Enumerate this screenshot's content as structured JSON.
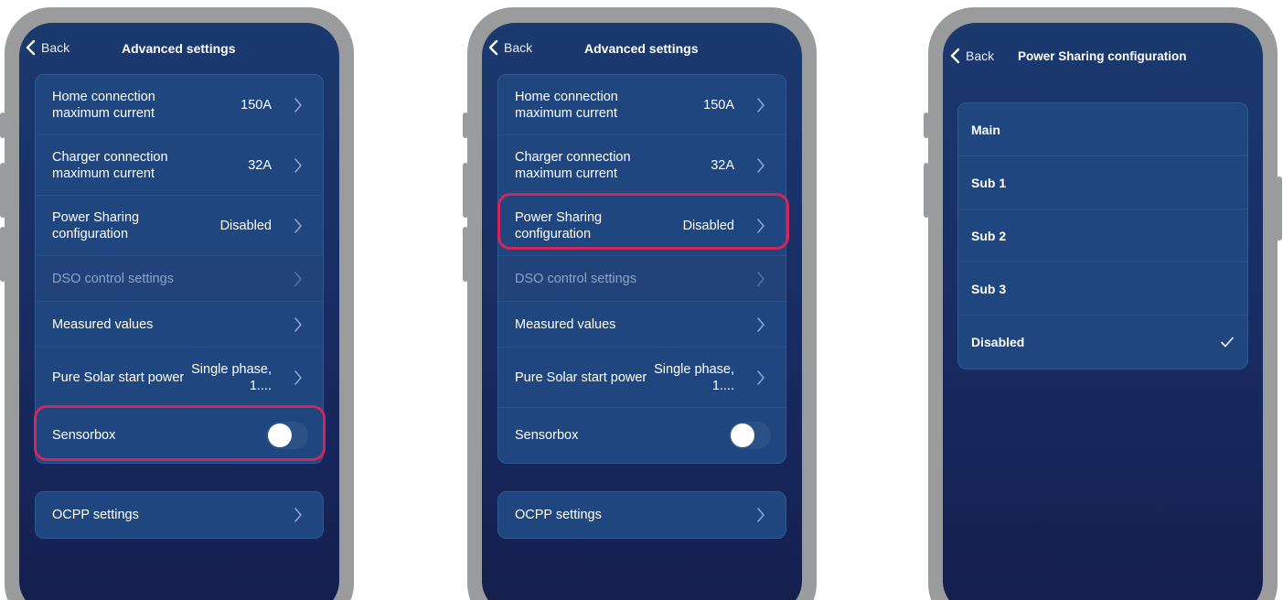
{
  "panels": [
    {
      "back_label": "Back",
      "title": "Advanced settings",
      "rows": [
        {
          "label": "Home connection maximum current",
          "value": "150A"
        },
        {
          "label": "Charger connection maximum current",
          "value": "32A"
        },
        {
          "label": "Power Sharing configuration",
          "value": "Disabled"
        },
        {
          "label": "DSO control settings",
          "value": ""
        },
        {
          "label": "Measured values",
          "value": ""
        },
        {
          "label": "Pure Solar start power",
          "value": "Single phase, 1...."
        },
        {
          "label": "Sensorbox",
          "value": ""
        }
      ],
      "sensorbox_on": false,
      "ocpp_label": "OCPP settings",
      "highlight": "Sensorbox"
    },
    {
      "back_label": "Back",
      "title": "Advanced settings",
      "rows": [
        {
          "label": "Home connection maximum current",
          "value": "150A"
        },
        {
          "label": "Charger connection maximum current",
          "value": "32A"
        },
        {
          "label": "Power Sharing configuration",
          "value": "Disabled"
        },
        {
          "label": "DSO control settings",
          "value": ""
        },
        {
          "label": "Measured values",
          "value": ""
        },
        {
          "label": "Pure Solar start power",
          "value": "Single phase, 1...."
        },
        {
          "label": "Sensorbox",
          "value": ""
        }
      ],
      "sensorbox_on": false,
      "ocpp_label": "OCPP settings",
      "highlight": "Power Sharing configuration"
    },
    {
      "back_label": "Back",
      "title": "Power Sharing configuration",
      "options": [
        "Main",
        "Sub 1",
        "Sub 2",
        "Sub 3",
        "Disabled"
      ],
      "selected": "Disabled"
    }
  ],
  "colors": {
    "highlight": "#d4245a",
    "card": "#1f467f",
    "disabled_text": "#8fa4c4"
  }
}
